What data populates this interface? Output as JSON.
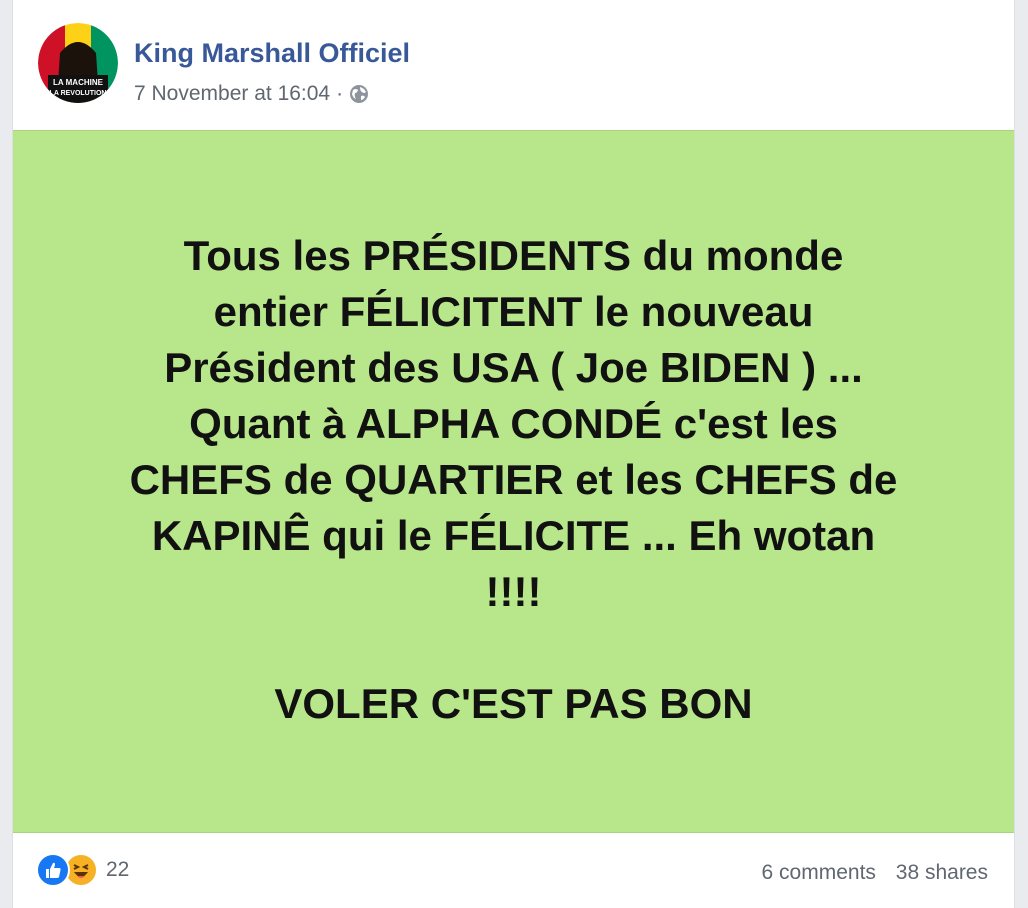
{
  "post": {
    "author": "King Marshall Officiel",
    "timestamp": "7 November at 16:04",
    "separator": "·",
    "privacy_icon": "globe-icon",
    "avatar_text_line1": "LA MACHINE",
    "avatar_text_line2": "LA REVOLUTION",
    "background_color": "#b8e68a",
    "text": "Tous les PRÉSIDENTS du monde\nentier FÉLICITENT le nouveau\nPrésident des USA ( Joe BIDEN ) ...\nQuant à ALPHA CONDÉ c'est les\nCHEFS de QUARTIER et les CHEFS de\nKAPINÊ qui le FÉLICITE ... Eh wotan\n!!!!\n\nVOLER C'EST PAS BON"
  },
  "footer": {
    "reaction_icons": [
      "like-icon",
      "haha-icon"
    ],
    "reaction_count": "22",
    "comments": "6 comments",
    "shares": "38 shares"
  },
  "colors": {
    "author_link": "#385898",
    "meta_text": "#606770",
    "like_blue": "#1877f2",
    "haha_yellow": "#f7b125"
  }
}
